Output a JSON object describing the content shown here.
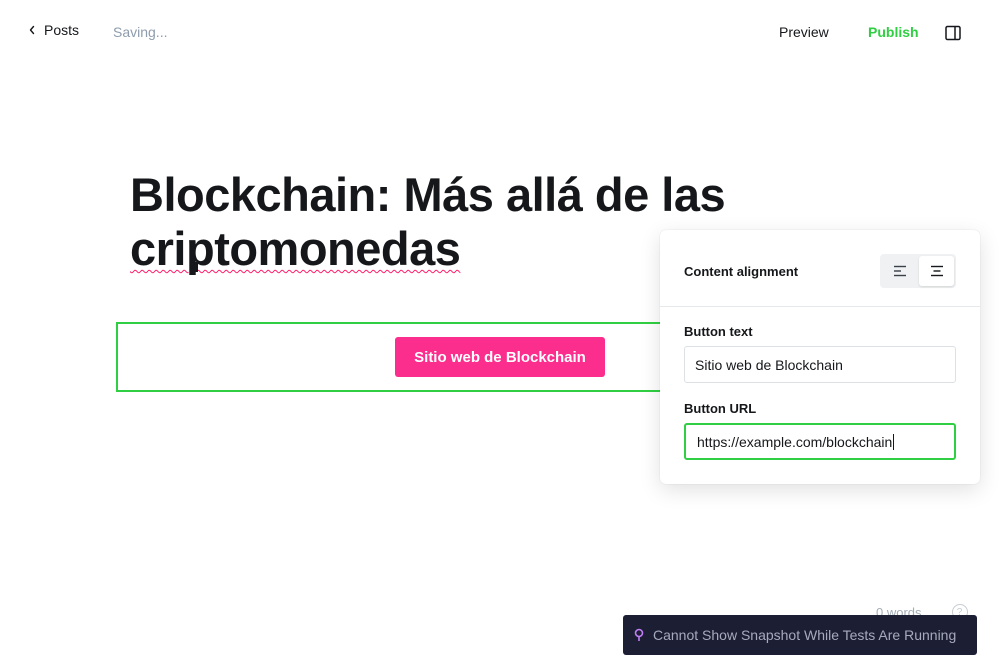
{
  "topbar": {
    "back_label": "Posts",
    "status": "Saving...",
    "preview_label": "Preview",
    "publish_label": "Publish"
  },
  "post": {
    "title_line1": "Blockchain: Más allá de las",
    "title_line2": "criptomonedas"
  },
  "button_card": {
    "button_text": "Sitio web de Blockchain"
  },
  "settings_panel": {
    "content_alignment_label": "Content alignment",
    "alignment_options": [
      "left",
      "center"
    ],
    "alignment_selected": "center",
    "button_text_label": "Button text",
    "button_text_value": "Sitio web de Blockchain",
    "button_url_label": "Button URL",
    "button_url_value": "https://example.com/blockchain"
  },
  "footer": {
    "word_count": "0 words",
    "help_glyph": "?"
  },
  "snapshot_banner": {
    "message": "Cannot Show Snapshot While Tests Are Running"
  },
  "colors": {
    "accent_green": "#30cf43",
    "cta_pink": "#fb2d8d",
    "banner_bg": "#1c1f33",
    "muted": "#8e9cac"
  }
}
